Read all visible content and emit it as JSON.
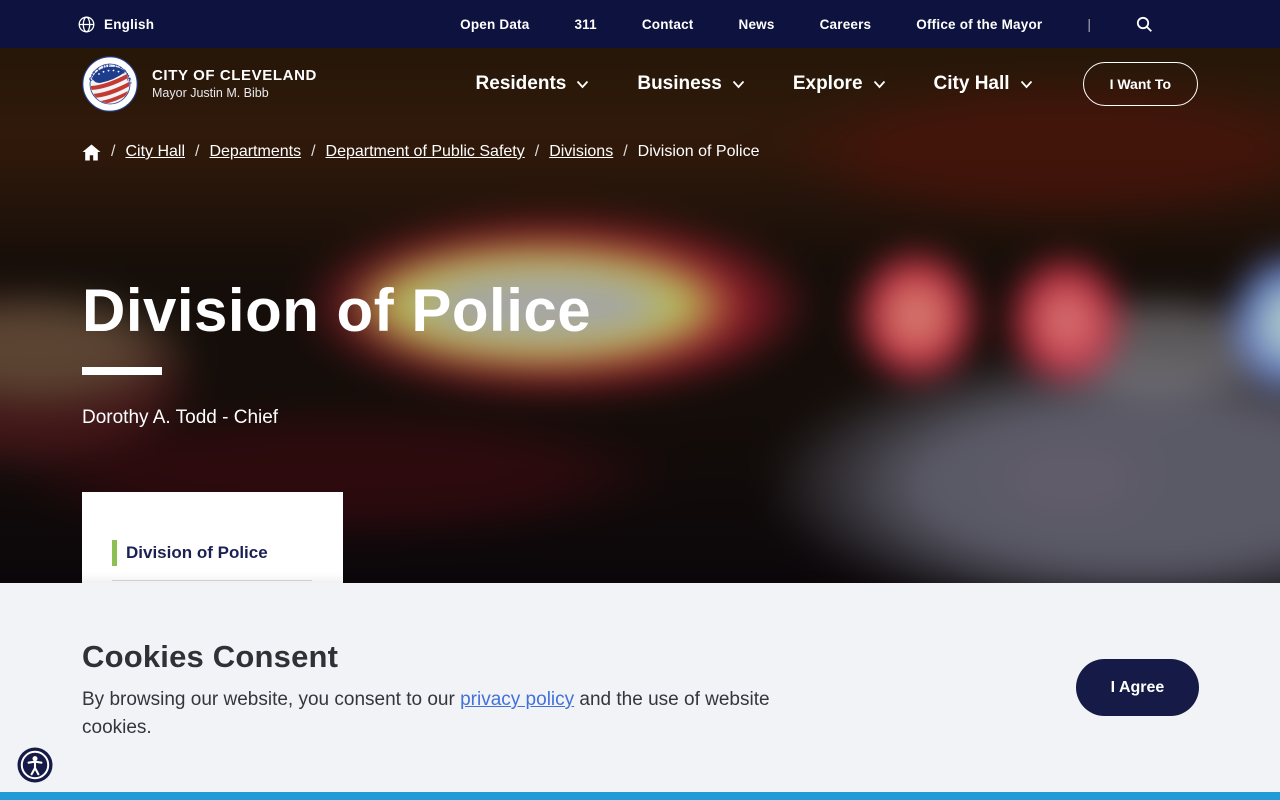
{
  "utility_bar": {
    "language_label": "English",
    "links": [
      "Open Data",
      "311",
      "Contact",
      "News",
      "Careers",
      "Office of the Mayor"
    ],
    "separator": "|"
  },
  "header": {
    "logo_title": "CITY OF CLEVELAND",
    "logo_subtitle": "Mayor Justin M. Bibb",
    "nav": [
      {
        "label": "Residents"
      },
      {
        "label": "Business"
      },
      {
        "label": "Explore"
      },
      {
        "label": "City Hall"
      }
    ],
    "cta_label": "I Want To"
  },
  "breadcrumb": {
    "separator": "/",
    "items": [
      {
        "label": "City Hall"
      },
      {
        "label": "Departments"
      },
      {
        "label": "Department of Public Safety"
      },
      {
        "label": "Divisions"
      },
      {
        "label": "Division of Police"
      }
    ]
  },
  "hero": {
    "title": "Division of Police",
    "subtitle": "Dorothy A. Todd - Chief"
  },
  "side_card": {
    "active_item": "Division of Police"
  },
  "cookies": {
    "title": "Cookies Consent",
    "text_before_link": "By browsing our website, you consent to our ",
    "link_text": "privacy policy",
    "text_after_link": " and the use of website cookies.",
    "agree_label": "I Agree"
  },
  "icons": {
    "globe": "globe-icon",
    "search": "search-icon",
    "home": "home-icon",
    "chevron": "chevron-down-icon",
    "accessibility": "accessibility-icon",
    "seal": "city-of-cleveland-seal"
  },
  "colors": {
    "utility_navy": "#0e123e",
    "button_navy": "#151a46",
    "accent_green": "#8bc053",
    "footer_blue": "#219bd8",
    "overlay_bg": "#f1f3f7",
    "link_blue": "#4272d9",
    "card_text_navy": "#1b2153"
  }
}
